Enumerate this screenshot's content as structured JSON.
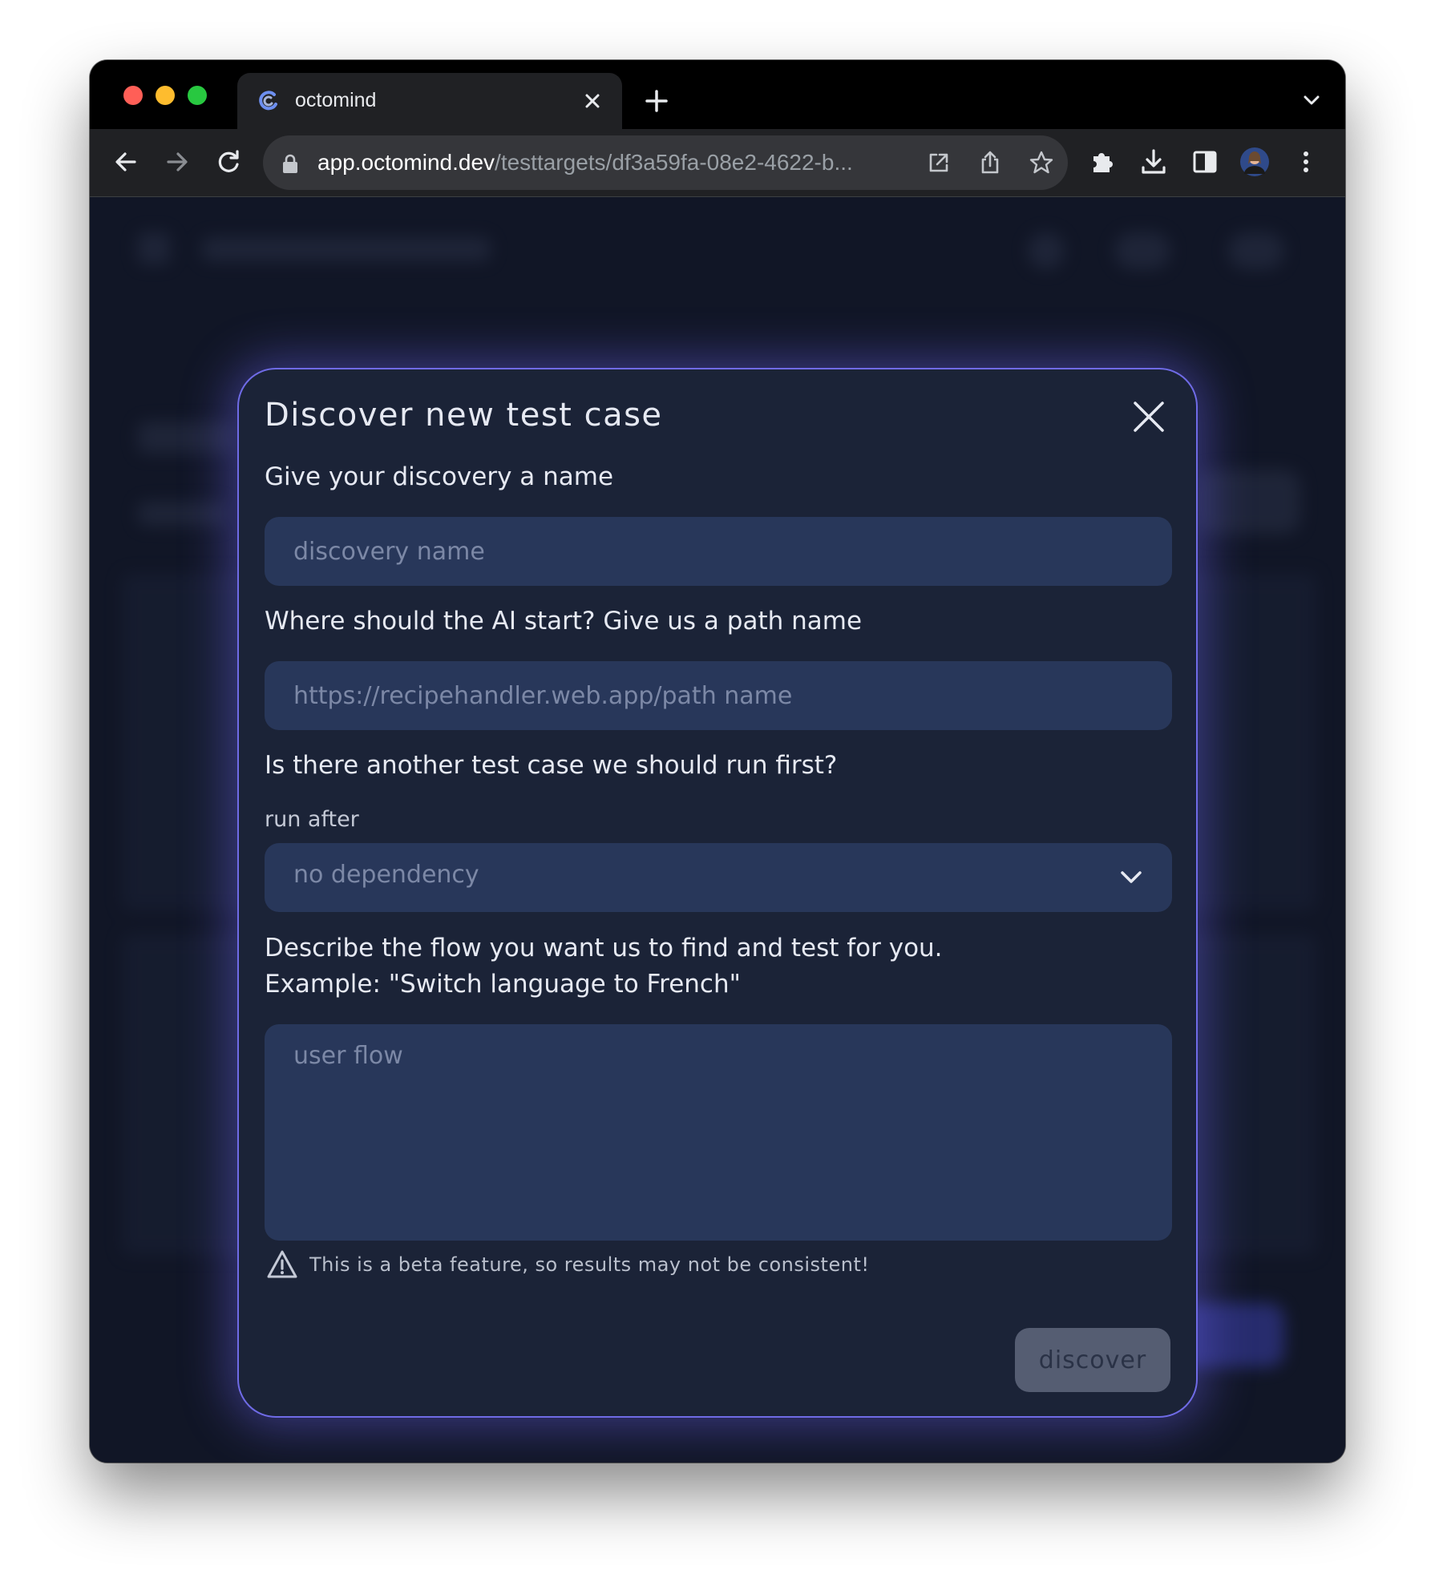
{
  "browser": {
    "tab": {
      "title": "octomind"
    },
    "address_bar": {
      "host": "app.octomind.dev",
      "path": "/testtargets/df3a59fa-08e2-4622-b..."
    }
  },
  "modal": {
    "title": "Discover new test case",
    "name_field": {
      "label": "Give your discovery a name",
      "placeholder": "discovery name"
    },
    "path_field": {
      "label": "Where should the AI start? Give us a path name",
      "placeholder": "https://recipehandler.web.app/path name"
    },
    "dependency": {
      "question": "Is there another test case we should run first?",
      "label": "run after",
      "selected": "no dependency"
    },
    "flow": {
      "label_line1": "Describe the flow you want us to find and test for you.",
      "label_line2": "Example: \"Switch language to French\"",
      "placeholder": "user flow"
    },
    "warning": "This is a beta feature, so results may not be consistent!",
    "submit_label": "discover"
  },
  "colors": {
    "modal_border": "#6f6be6",
    "modal_bg": "#1b2337",
    "field_bg": "#28375a",
    "button_bg": "#555d72"
  }
}
